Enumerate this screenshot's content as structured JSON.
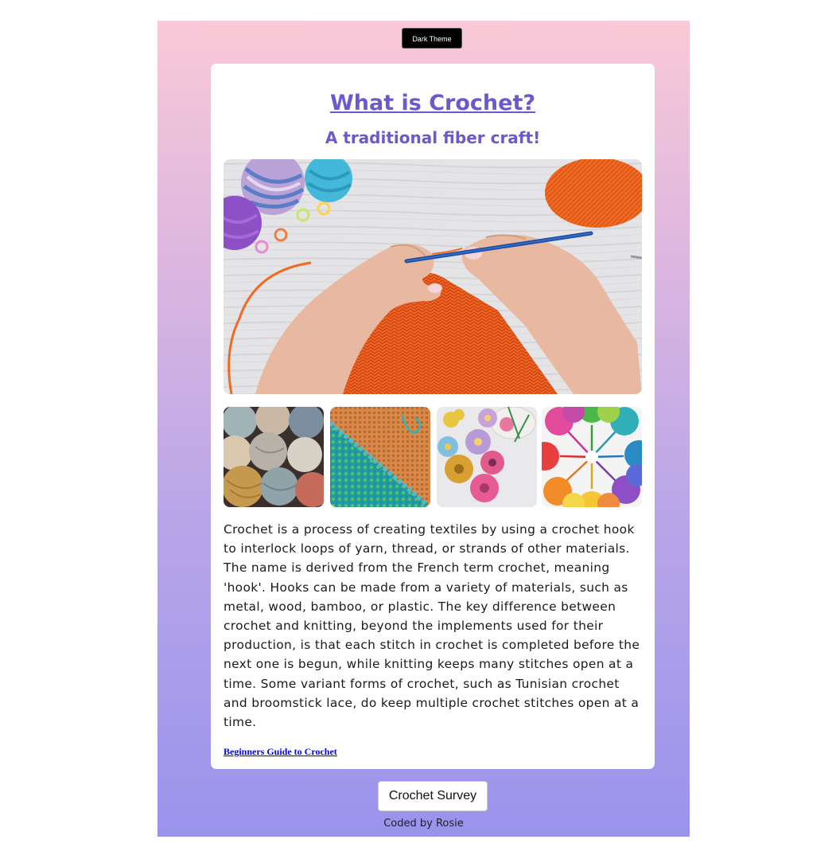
{
  "header": {
    "theme_button_label": "Dark Theme"
  },
  "article": {
    "title": "What is Crochet?",
    "subtitle": "A traditional fiber craft!",
    "body": "Crochet is a process of creating textiles by using a crochet hook to interlock loops of yarn, thread, or strands of other materials. The name is derived from the French term crochet, meaning 'hook'. Hooks can be made from a variety of materials, such as metal, wood, bamboo, or plastic. The key difference between crochet and knitting, beyond the implements used for their production, is that each stitch in crochet is completed before the next one is begun, while knitting keeps many stitches open at a time. Some variant forms of crochet, such as Tunisian crochet and broomstick lace, do keep multiple crochet stitches open at a time.",
    "link_label": "Beginners Guide to Crochet"
  },
  "footer": {
    "survey_button_label": "Crochet Survey",
    "credit": "Coded by Rosie"
  },
  "colors": {
    "accent": "#6a5acd",
    "gradient_top": "#f9c9d6",
    "gradient_bottom": "#9a93ec",
    "yarn_orange": "#f05a1e"
  }
}
